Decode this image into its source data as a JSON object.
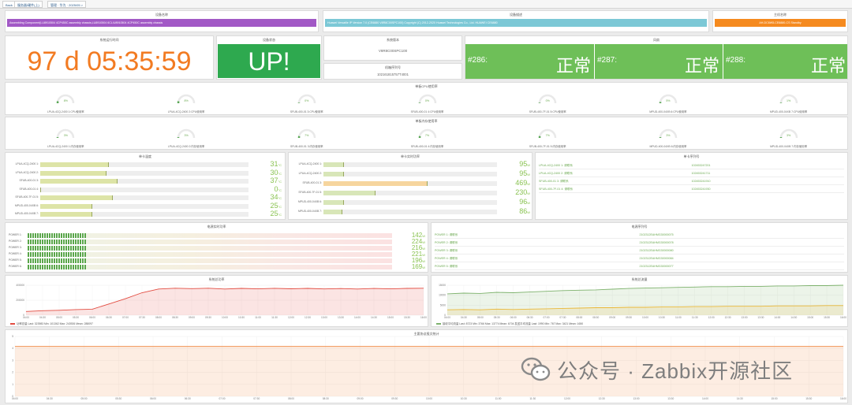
{
  "tabs": [
    {
      "label": "Back"
    },
    {
      "label": "服务器/硬件(上)"
    },
    {
      "label": "管理 · 华为 · 2025/05 >"
    }
  ],
  "header": {
    "device_name": {
      "title": "设备名称",
      "value": "Assembling Component(LU8910504 4CP450C assembly chassis,LU8910504 6CL/U8910504 4CP450C assembly chassis",
      "color": "#a259c6"
    },
    "device_desc": {
      "title": "设备描述",
      "value": "Huawei Versatile IP Version 7.0 (CE6880 V8R8C00SPC100) Copyright (C) 2012-2020 Huawei Technologies Co., Ltd. HUAWEI CE6880",
      "color": "#7cc8d6"
    },
    "main_name": {
      "title": "主机名称",
      "value": "AH-DC6W5-CE6880-CS Standby",
      "color": "#f58a1f"
    }
  },
  "uptime": {
    "title": "系统运行时间",
    "value": "97 d 05:35:59"
  },
  "status": {
    "title": "设备状态",
    "value": "UP!"
  },
  "version": {
    "title": "系统版本",
    "value": "V8R8C00SPC100"
  },
  "serial": {
    "title": "机箱序列号",
    "value": "102161815757T4001"
  },
  "fans": {
    "title": "风扇",
    "items": [
      {
        "id": "#286:",
        "state": "正常"
      },
      {
        "id": "#287:",
        "state": "正常"
      },
      {
        "id": "#288:",
        "state": "正常"
      }
    ]
  },
  "cpu": {
    "title": "单板CPU使用率",
    "items": [
      {
        "label": "LPUA-4CQ-2400 1:CPU使用率",
        "value": "8%",
        "pct": 8
      },
      {
        "label": "LPUA-4CQ-2400 2:CPU使用率",
        "value": "8%",
        "pct": 8
      },
      {
        "label": "SFUB-400-01 3:CPU使用率",
        "value": "0%",
        "pct": 0
      },
      {
        "label": "SFUB-400-01 4:CPU使用率",
        "value": "0%",
        "pct": 0
      },
      {
        "label": "SFUB-400-7F-01 5:CPU使用率",
        "value": "0%",
        "pct": 0
      },
      {
        "label": "MPUD-400-04XB 6:CPU使用率",
        "value": "5%",
        "pct": 5
      },
      {
        "label": "MPUD-400-04XB 7:CPU使用率",
        "value": "1%",
        "pct": 1
      }
    ]
  },
  "mem": {
    "title": "单板内存使用率",
    "items": [
      {
        "label": "LPUA-4CQ-2400 1:内存使用率",
        "value": "3%",
        "pct": 3
      },
      {
        "label": "LPUA-4CQ-2400 2:内存使用率",
        "value": "3%",
        "pct": 3
      },
      {
        "label": "SFUB-400-01 3:内存使用率",
        "value": "7%",
        "pct": 7
      },
      {
        "label": "SFUB-400-01 4:内存使用率",
        "value": "7%",
        "pct": 7
      },
      {
        "label": "SFUB-400-7F-01 5:内存使用率",
        "value": "7%",
        "pct": 7
      },
      {
        "label": "MPUD-400-04XB 6:内存使用率",
        "value": "3%",
        "pct": 3
      },
      {
        "label": "MPUD-400-04XB 7:内存使用率",
        "value": "3%",
        "pct": 3
      }
    ]
  },
  "temp": {
    "title": "单卡温度",
    "unit": "°C",
    "items": [
      {
        "label": "LPUA-4CQ-2400 1:",
        "value": "31",
        "pct": 33
      },
      {
        "label": "LPUA-4CQ-2400 2:",
        "value": "30",
        "pct": 32
      },
      {
        "label": "SFUB-400-01 3:",
        "value": "37",
        "pct": 37
      },
      {
        "label": "SFUB-400-01 4:",
        "value": "0",
        "pct": 0
      },
      {
        "label": "SFUB-400-7F-01 5:",
        "value": "34",
        "pct": 35
      },
      {
        "label": "MPUD-400-04XB 6:",
        "value": "25",
        "pct": 25
      },
      {
        "label": "MPUD-400-04XB 7:",
        "value": "25",
        "pct": 25
      }
    ]
  },
  "power": {
    "title": "单卡实时功率",
    "unit": "W",
    "items": [
      {
        "label": "LPUA-4CQ-2400 1:",
        "value": "95",
        "pct": 12
      },
      {
        "label": "LPUA-4CQ-2400 2:",
        "value": "95",
        "pct": 12
      },
      {
        "label": "SFUB-400-01 3:",
        "value": "469",
        "pct": 60
      },
      {
        "label": "SFUB-400-7F-01 5:",
        "value": "230",
        "pct": 30
      },
      {
        "label": "MPUD-400-04XB 6:",
        "value": "96",
        "pct": 12
      },
      {
        "label": "MPUD-400-04XB 7:",
        "value": "86",
        "pct": 11
      }
    ]
  },
  "card_serial": {
    "title": "单卡序列号",
    "rows": [
      {
        "name": "LPUA-4CQ-2400 1: 请联系",
        "sn": "102453247201"
      },
      {
        "name": "LPUA-4CQ-2400 2: 请联系",
        "sn": "102453241711"
      },
      {
        "name": "SFUB-400-01 3: 请联系",
        "sn": "102453241910"
      },
      {
        "name": "SFUB-400-7F-01 4: 请联系",
        "sn": "102453241930"
      }
    ]
  },
  "psu_power": {
    "title": "电源实时功率",
    "unit": "W",
    "items": [
      {
        "label": "POWER 1:",
        "value": "142",
        "pct": 16
      },
      {
        "label": "POWER 2:",
        "value": "224",
        "pct": 16
      },
      {
        "label": "POWER 3:",
        "value": "216",
        "pct": 16
      },
      {
        "label": "POWER 4:",
        "value": "221",
        "pct": 16
      },
      {
        "label": "POWER 5:",
        "value": "196",
        "pct": 16
      },
      {
        "label": "POWER 6:",
        "value": "169",
        "pct": 16
      }
    ]
  },
  "psu_serial": {
    "title": "电源序列号",
    "rows": [
      {
        "name": "POWER 1: 请联系",
        "sn": "2102312EAHMG30000075"
      },
      {
        "name": "POWER 2: 请联系",
        "sn": "2102312EAHMG30000078"
      },
      {
        "name": "POWER 3: 请联系",
        "sn": "2102312EAHMG30000080"
      },
      {
        "name": "POWER 4: 请联系",
        "sn": "2102312EAHMG30000084"
      },
      {
        "name": "POWER 5: 请联系",
        "sn": "2102312EAHMG30000077"
      }
    ]
  },
  "chart_data": [
    {
      "type": "area",
      "title": "系统总功率",
      "x": [
        "04:00",
        "04:30",
        "05:00",
        "05:30",
        "06:00",
        "06:30",
        "07:00",
        "07:30",
        "08:00",
        "08:30",
        "09:00",
        "09:30",
        "10:00",
        "10:30",
        "11:00",
        "11:30",
        "12:00",
        "12:30",
        "13:00",
        "13:30",
        "14:00",
        "14:30",
        "15:00",
        "15:30",
        "16:00"
      ],
      "series": [
        {
          "name": "功率总量",
          "values": [
            5000,
            6000,
            6500,
            7500,
            8000,
            15000,
            22000,
            30000,
            35000,
            36000,
            35500,
            36000,
            35000,
            35800,
            35200,
            35900,
            35300,
            35800,
            35100,
            35600,
            35000,
            35700,
            35200,
            35800,
            36000
          ],
          "color": "#e24d42"
        }
      ],
      "ylim": [
        0,
        40000
      ],
      "ytick": [
        "0",
        "200000",
        "400000"
      ],
      "legend": "功率总量 Last: 323983 Min: 101362 Max: 243926 Mean: 288097"
    },
    {
      "type": "line",
      "title": "系统总流量",
      "x": [
        "04:00",
        "04:30",
        "05:00",
        "05:30",
        "06:00",
        "06:30",
        "07:00",
        "07:30",
        "08:00",
        "08:30",
        "09:00",
        "09:30",
        "10:00",
        "10:30",
        "11:00",
        "11:30",
        "12:00",
        "12:30",
        "13:00",
        "13:30",
        "14:00",
        "14:30",
        "15:00",
        "15:30",
        "16:00"
      ],
      "series": [
        {
          "name": "接收平均流量",
          "values": [
            6000,
            6200,
            6100,
            6400,
            6300,
            6500,
            6700,
            6900,
            7000,
            7100,
            7300,
            7500,
            7600,
            7700,
            7800,
            7900,
            8000,
            8000,
            8100,
            8100,
            8200,
            8200,
            8300,
            8300,
            8400
          ],
          "color": "#7eb26d"
        },
        {
          "name": "发送平均流量",
          "values": [
            1500,
            1600,
            1500,
            1700,
            1600,
            1700,
            1800,
            1900,
            2000,
            2100,
            2100,
            2200,
            2200,
            2300,
            2300,
            2400,
            2400,
            2500,
            2500,
            2500,
            2600,
            2600,
            2600,
            2700,
            2700
          ],
          "color": "#eab839"
        }
      ],
      "ytick": [
        "0",
        "5000",
        "10000",
        "15000"
      ],
      "legend": "接收平均流量 Last: 8723 Min: 3766 Max: 13774 Mean: 6704  发送平均流量 Last: 1990 Min: 767 Max: 3421 Mean: 1650"
    },
    {
      "type": "line",
      "title": "主要协议报文统计",
      "x": [
        "04:00",
        "04:30",
        "05:00",
        "05:30",
        "06:00",
        "06:30",
        "07:00",
        "07:30",
        "08:00",
        "08:30",
        "09:00",
        "09:30",
        "10:00",
        "10:30",
        "11:00",
        "11:30",
        "12:00",
        "12:30",
        "13:00",
        "13:30",
        "14:00",
        "14:30",
        "15:00",
        "15:30",
        "16:00"
      ],
      "series": [
        {
          "name": "",
          "values": [
            5,
            5,
            5,
            5,
            5,
            5,
            5,
            5,
            5,
            5,
            5,
            5,
            5,
            5,
            5,
            5,
            5,
            5,
            5,
            5,
            5,
            5,
            5,
            5,
            5
          ],
          "color": "#ef843c"
        }
      ],
      "ylim": [
        0,
        6
      ],
      "ytick": [
        "0",
        "1",
        "2",
        "3",
        "4",
        "5"
      ]
    }
  ],
  "watermark": "公众号 · Zabbix开源社区"
}
